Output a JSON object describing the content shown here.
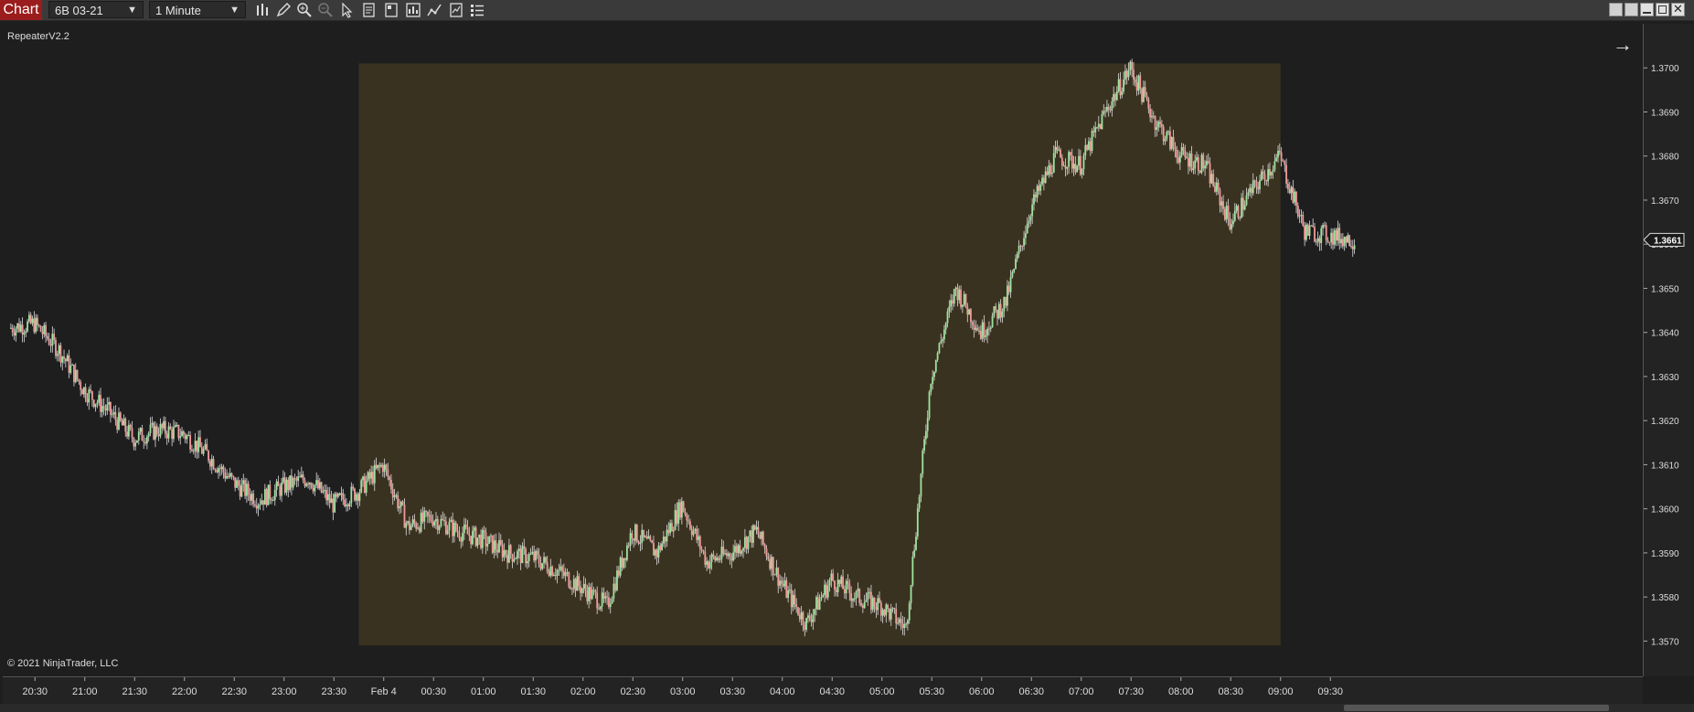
{
  "toolbar": {
    "chart_tab": "Chart",
    "instrument": "6B 03-21",
    "interval": "1 Minute",
    "icons": [
      "bar-type-icon",
      "draw-pencil-icon",
      "zoom-in-icon",
      "zoom-out-icon",
      "pointer-icon",
      "data-box-icon",
      "properties-icon",
      "template-icon",
      "indicators-icon",
      "strategies-icon",
      "list-icon"
    ]
  },
  "indicator_label": "RepeaterV2.2",
  "copyright": "© 2021 NinjaTrader, LLC",
  "nav_arrow": "→",
  "price_axis": {
    "ticks": [
      "1.3700",
      "1.3690",
      "1.3680",
      "1.3670",
      "1.3660",
      "1.3650",
      "1.3640",
      "1.3630",
      "1.3620",
      "1.3610",
      "1.3600",
      "1.3590",
      "1.3580",
      "1.3570"
    ],
    "last_price": "1.3661"
  },
  "time_axis": {
    "ticks": [
      "20:30",
      "21:00",
      "21:30",
      "22:00",
      "22:30",
      "23:00",
      "23:30",
      "Feb 4",
      "00:30",
      "01:00",
      "01:30",
      "02:00",
      "02:30",
      "03:00",
      "03:30",
      "04:00",
      "04:30",
      "05:00",
      "05:30",
      "06:00",
      "06:30",
      "07:00",
      "07:30",
      "08:00",
      "08:30",
      "09:00",
      "09:30"
    ]
  },
  "colors": {
    "background": "#1e1e1e",
    "highlight_box": "#3a3220",
    "up_candle": "#9ee39e",
    "down_candle": "#f09a9a",
    "wick": "#dddddd",
    "chart_tab": "#9b1c1c"
  },
  "chart_data": {
    "type": "candlestick",
    "title": "",
    "instrument": "6B 03-21",
    "interval": "1 Minute",
    "ylim": [
      1.3562,
      1.371
    ],
    "x": [
      "20:15",
      "20:30",
      "20:45",
      "21:00",
      "21:15",
      "21:30",
      "21:45",
      "22:00",
      "22:15",
      "22:30",
      "22:45",
      "23:00",
      "23:15",
      "23:30",
      "23:45",
      "Feb 4 00:00",
      "00:15",
      "00:30",
      "00:45",
      "01:00",
      "01:15",
      "01:30",
      "01:45",
      "02:00",
      "02:15",
      "02:30",
      "02:45",
      "03:00",
      "03:15",
      "03:30",
      "03:45",
      "04:00",
      "04:15",
      "04:30",
      "04:45",
      "05:00",
      "05:15",
      "05:30",
      "05:45",
      "06:00",
      "06:15",
      "06:30",
      "06:45",
      "07:00",
      "07:15",
      "07:30",
      "07:45",
      "08:00",
      "08:15",
      "08:30",
      "08:45",
      "09:00",
      "09:15",
      "09:30",
      "09:45"
    ],
    "close": [
      1.3641,
      1.3642,
      1.3636,
      1.3627,
      1.3622,
      1.3616,
      1.3618,
      1.3617,
      1.3612,
      1.3606,
      1.3602,
      1.3605,
      1.3607,
      1.3601,
      1.3604,
      1.361,
      1.3596,
      1.3598,
      1.3595,
      1.3593,
      1.359,
      1.3589,
      1.3586,
      1.3582,
      1.3578,
      1.3595,
      1.359,
      1.3601,
      1.3588,
      1.359,
      1.3595,
      1.3583,
      1.3574,
      1.3584,
      1.358,
      1.3578,
      1.3573,
      1.363,
      1.365,
      1.364,
      1.3647,
      1.3668,
      1.368,
      1.3678,
      1.369,
      1.37,
      1.3688,
      1.368,
      1.3678,
      1.3665,
      1.3673,
      1.368,
      1.3663,
      1.3662,
      1.3661
    ],
    "highlight_range": {
      "start": "23:45",
      "end": "09:00",
      "price_low": 1.3569,
      "price_high": 1.3701
    }
  }
}
